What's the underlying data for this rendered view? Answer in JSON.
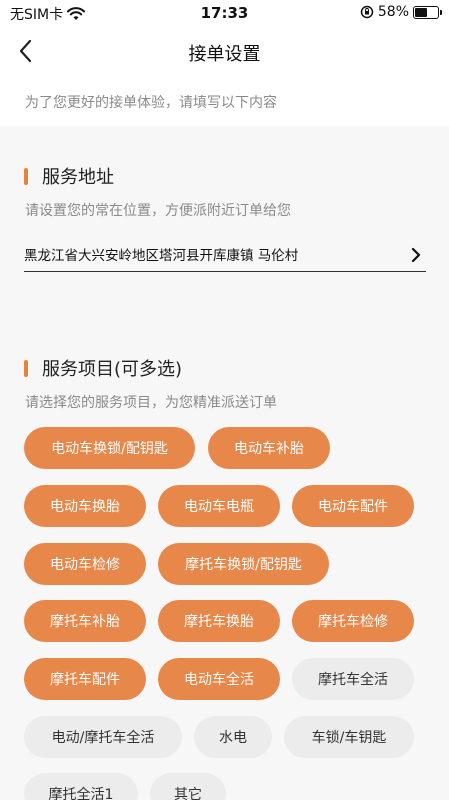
{
  "status_bar": {
    "carrier": "无SIM卡",
    "time": "17:33",
    "battery_percent": "58%",
    "battery_level": 0.58
  },
  "nav": {
    "title": "接单设置",
    "back_icon": "chevron-left-icon"
  },
  "subheader": {
    "text": "为了您更好的接单体验，请填写以下内容"
  },
  "address_section": {
    "title": "服务地址",
    "description": "请设置您的常在位置，方便派附近订单给您",
    "address": "黑龙江省大兴安岭地区塔河县开库康镇 马伦村"
  },
  "services_section": {
    "title": "服务项目(可多选)",
    "description": "请选择您的服务项目，为您精准派送订单",
    "items": [
      {
        "label": "电动车换锁/配钥匙",
        "selected": true
      },
      {
        "label": "电动车补胎",
        "selected": true
      },
      {
        "label": "电动车换胎",
        "selected": true
      },
      {
        "label": "电动车电瓶",
        "selected": true
      },
      {
        "label": "电动车配件",
        "selected": true
      },
      {
        "label": "电动车检修",
        "selected": true
      },
      {
        "label": "摩托车换锁/配钥匙",
        "selected": true
      },
      {
        "label": "摩托车补胎",
        "selected": true
      },
      {
        "label": "摩托车换胎",
        "selected": true
      },
      {
        "label": "摩托车检修",
        "selected": true
      },
      {
        "label": "摩托车配件",
        "selected": true
      },
      {
        "label": "电动车全活",
        "selected": true
      },
      {
        "label": "摩托车全活",
        "selected": false
      },
      {
        "label": "电动/摩托车全活",
        "selected": false
      },
      {
        "label": "水电",
        "selected": false
      },
      {
        "label": "车锁/车钥匙",
        "selected": false
      },
      {
        "label": "摩托全活1",
        "selected": false
      },
      {
        "label": "其它",
        "selected": false
      }
    ]
  },
  "colors": {
    "accent": "#e8874a",
    "chip_unselected": "#ececec"
  }
}
